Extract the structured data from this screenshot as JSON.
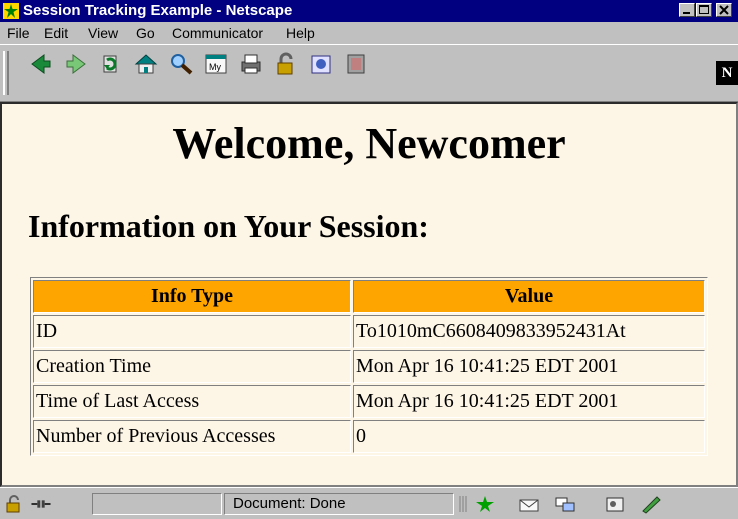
{
  "window": {
    "title": "Session Tracking Example - Netscape",
    "app_icon": "netscape-icon",
    "controls": [
      "minimize-icon",
      "maximize-icon",
      "close-icon"
    ]
  },
  "menu": {
    "items": [
      {
        "label": "File",
        "accel": "F"
      },
      {
        "label": "Edit",
        "accel": "E"
      },
      {
        "label": "View",
        "accel": "V"
      },
      {
        "label": "Go",
        "accel": "G"
      },
      {
        "label": "Communicator",
        "accel": "C"
      },
      {
        "label": "Help",
        "accel": "H"
      }
    ]
  },
  "toolbar": {
    "icons": [
      "back-icon",
      "forward-icon",
      "reload-icon",
      "home-icon",
      "search-icon",
      "my-netscape-icon",
      "print-icon",
      "security-icon",
      "shop-icon",
      "stop-icon"
    ],
    "my_label": "My",
    "logo": "N"
  },
  "page": {
    "heading": "Welcome, Newcomer",
    "subheading": "Information on Your Session:",
    "table": {
      "headers": [
        "Info Type",
        "Value"
      ],
      "header_color": "#ffa500",
      "rows": [
        [
          "ID",
          "To1010mC6608409833952431At"
        ],
        [
          "Creation Time",
          "Mon Apr 16 10:41:25 EDT 2001"
        ],
        [
          "Time of Last Access",
          "Mon Apr 16 10:41:25 EDT 2001"
        ],
        [
          "Number of Previous Accesses",
          "0"
        ]
      ]
    },
    "background": "#fdf5e6"
  },
  "status": {
    "text": "Document: Done",
    "icons": [
      "lock-icon",
      "connection-icon",
      "netscape-star-icon",
      "mail-icon",
      "discussion-icon",
      "address-book-icon",
      "composer-icon"
    ]
  }
}
